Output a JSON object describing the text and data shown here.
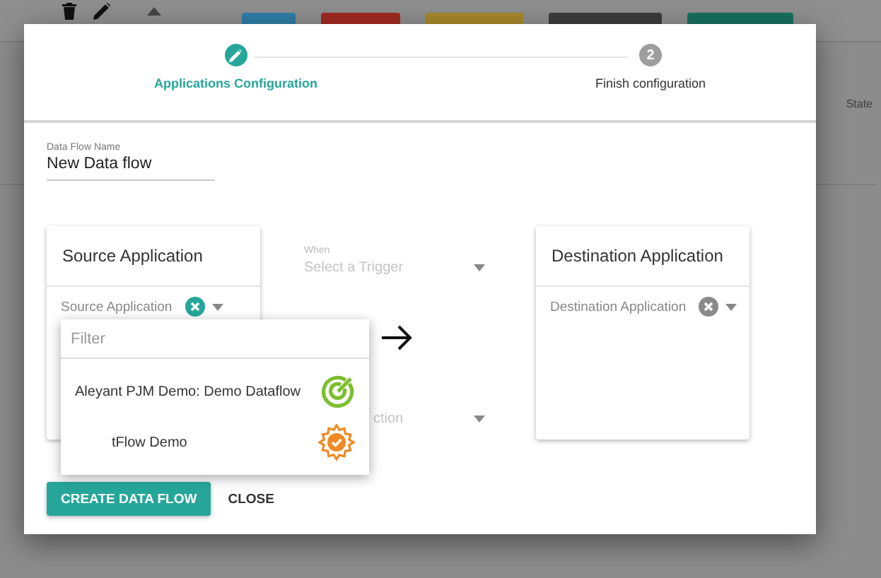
{
  "background_toolbar": {
    "filter_buttons": [
      {
        "color": "#2f7ea8"
      },
      {
        "color": "#a12a22"
      },
      {
        "color": "#a8882b"
      },
      {
        "color": "#3d3d3d"
      },
      {
        "color": "#17705f"
      }
    ]
  },
  "background_table": {
    "column_header": "State"
  },
  "stepper": {
    "steps": [
      {
        "label": "Applications Configuration",
        "selected": true
      },
      {
        "label": "Finish configuration",
        "number": "2",
        "selected": false
      }
    ]
  },
  "name_field": {
    "label": "Data Flow Name",
    "value": "New Data flow"
  },
  "source": {
    "title": "Source Application",
    "placeholder": "Source Application",
    "focused": true
  },
  "trigger": {
    "label": "When",
    "placeholder": "Select a Trigger"
  },
  "action": {
    "visible_text": "ction"
  },
  "destination": {
    "title": "Destination Application",
    "placeholder": "Destination Application",
    "focused": false
  },
  "dropdown": {
    "filter_placeholder": "Filter",
    "options": [
      {
        "label": "Aleyant PJM Demo: Demo Dataflow",
        "kind": "target"
      },
      {
        "label": "tFlow Demo",
        "kind": "gear"
      }
    ]
  },
  "buttons": [
    {
      "label": "CREATE DATA FLOW",
      "kind": "primary"
    },
    {
      "label": "CLOSE",
      "kind": "flat"
    }
  ]
}
